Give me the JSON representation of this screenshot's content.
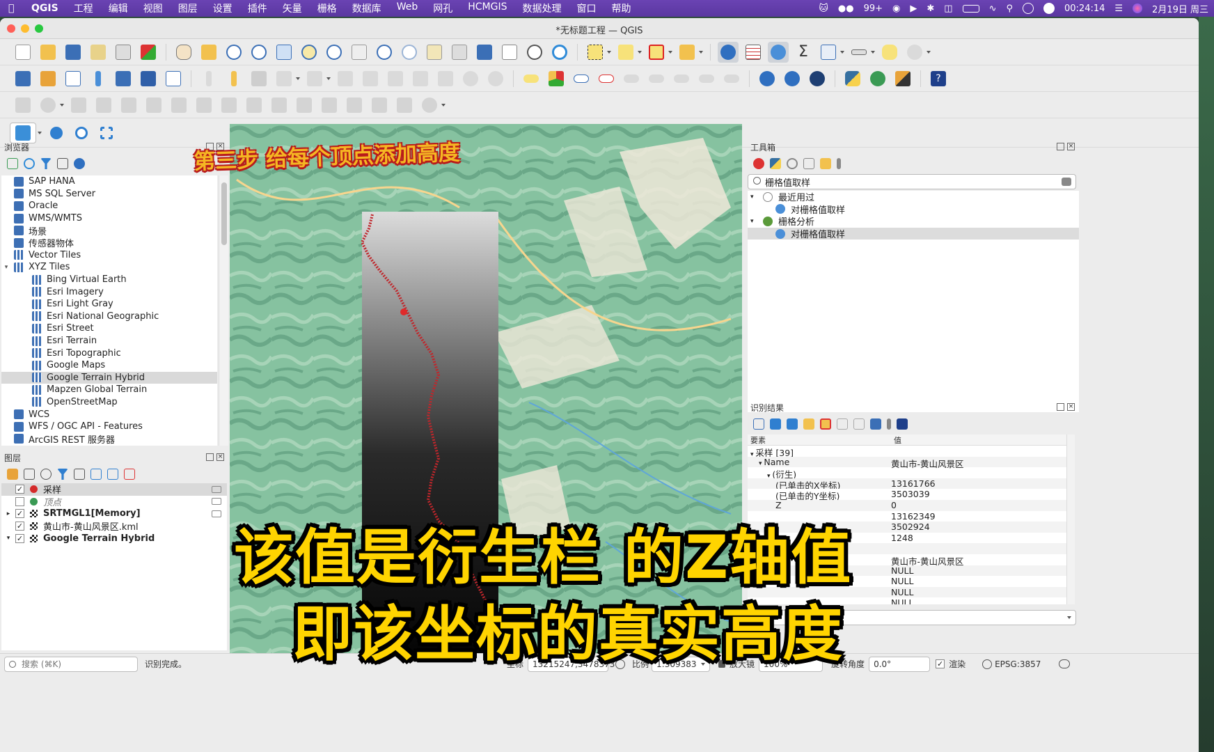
{
  "menubar": {
    "app": "QGIS",
    "items": [
      "工程",
      "编辑",
      "视图",
      "图层",
      "设置",
      "插件",
      "矢量",
      "栅格",
      "数据库",
      "Web",
      "网孔",
      "HCMGIS",
      "数据处理",
      "窗口",
      "帮助"
    ],
    "badge": "99+",
    "clock": "00:24:14",
    "date": "2月19日 周三"
  },
  "window": {
    "title": "*无标题工程 — QGIS"
  },
  "browser": {
    "title": "浏览器",
    "items": [
      {
        "label": "SAP HANA",
        "indent": 1
      },
      {
        "label": "MS SQL Server",
        "indent": 1
      },
      {
        "label": "Oracle",
        "indent": 1
      },
      {
        "label": "WMS/WMTS",
        "indent": 1
      },
      {
        "label": "场景",
        "indent": 1
      },
      {
        "label": "传感器物体",
        "indent": 1
      },
      {
        "label": "Vector Tiles",
        "indent": 1
      },
      {
        "label": "XYZ Tiles",
        "indent": 1
      },
      {
        "label": "Bing Virtual Earth",
        "indent": 2
      },
      {
        "label": "Esri Imagery",
        "indent": 2
      },
      {
        "label": "Esri Light Gray",
        "indent": 2
      },
      {
        "label": "Esri National Geographic",
        "indent": 2
      },
      {
        "label": "Esri Street",
        "indent": 2
      },
      {
        "label": "Esri Terrain",
        "indent": 2
      },
      {
        "label": "Esri Topographic",
        "indent": 2
      },
      {
        "label": "Google Maps",
        "indent": 2
      },
      {
        "label": "Google Terrain Hybrid",
        "indent": 2
      },
      {
        "label": "Mapzen Global Terrain",
        "indent": 2
      },
      {
        "label": "OpenStreetMap",
        "indent": 2
      },
      {
        "label": "WCS",
        "indent": 1
      },
      {
        "label": "WFS / OGC API - Features",
        "indent": 1
      },
      {
        "label": "ArcGIS REST 服务器",
        "indent": 1
      }
    ]
  },
  "layers": {
    "title": "图层",
    "items": [
      {
        "label": "采样",
        "checked": true,
        "color": "#d42a2a"
      },
      {
        "label": "顶点",
        "checked": false,
        "color": "#3a9a54"
      },
      {
        "label": "SRTMGL1[Memory]",
        "checked": true
      },
      {
        "label": "黄山市-黄山风景区.kml",
        "checked": true
      },
      {
        "label": "Google Terrain Hybrid",
        "checked": true
      }
    ]
  },
  "toolbox": {
    "title": "工具箱",
    "search": "栅格值取样",
    "items": [
      {
        "label": "最近用过",
        "indent": 0
      },
      {
        "label": "对栅格值取样",
        "indent": 1
      },
      {
        "label": "栅格分析",
        "indent": 0
      },
      {
        "label": "对栅格值取样",
        "indent": 1
      }
    ]
  },
  "identify": {
    "title": "识别结果",
    "col_feature": "要素",
    "col_value": "值",
    "rows": [
      {
        "k": "采样 [39]",
        "v": "",
        "indent": 0
      },
      {
        "k": "Name",
        "v": "黄山市-黄山风景区",
        "indent": 1
      },
      {
        "k": "(衍生)",
        "v": "",
        "indent": 2
      },
      {
        "k": "(已单击的X坐标)",
        "v": "13161766",
        "indent": 3
      },
      {
        "k": "(已单击的Y坐标)",
        "v": "3503039",
        "indent": 3
      },
      {
        "k": "Z",
        "v": "0",
        "indent": 3
      },
      {
        "k": "",
        "v": "13162349",
        "indent": 3
      },
      {
        "k": "",
        "v": "3502924",
        "indent": 3
      },
      {
        "k": "",
        "v": "1248",
        "indent": 3
      },
      {
        "k": "",
        "v": "",
        "indent": 3
      },
      {
        "k": "",
        "v": "黄山市-黄山风景区",
        "indent": 3
      },
      {
        "k": "",
        "v": "NULL",
        "indent": 3
      },
      {
        "k": "",
        "v": "NULL",
        "indent": 3
      },
      {
        "k": "",
        "v": "NULL",
        "indent": 3
      },
      {
        "k": "",
        "v": "NULL",
        "indent": 3
      }
    ]
  },
  "statusbar": {
    "search_placeholder": "搜索 (⌘K)",
    "message": "识别完成。",
    "coord_label": "坐标",
    "coord_value": "13215247,3478373",
    "scale_label": "比例",
    "scale_value": "1:309383",
    "magnifier_label": "放大镜",
    "magnifier_value": "100%",
    "rotation_label": "旋转角度",
    "rotation_value": "0.0°",
    "render_label": "渲染",
    "crs": "EPSG:3857"
  },
  "captions": {
    "top": "第三步 给每个顶点添加高度",
    "line1": "该值是衍生栏 的Z轴值",
    "line2": "即该坐标的真实高度"
  },
  "colors": {
    "menubar": "#5a37a0",
    "caption_yellow": "#ffd400",
    "caption_orange": "#f5b623",
    "track_red": "#c0262b"
  }
}
